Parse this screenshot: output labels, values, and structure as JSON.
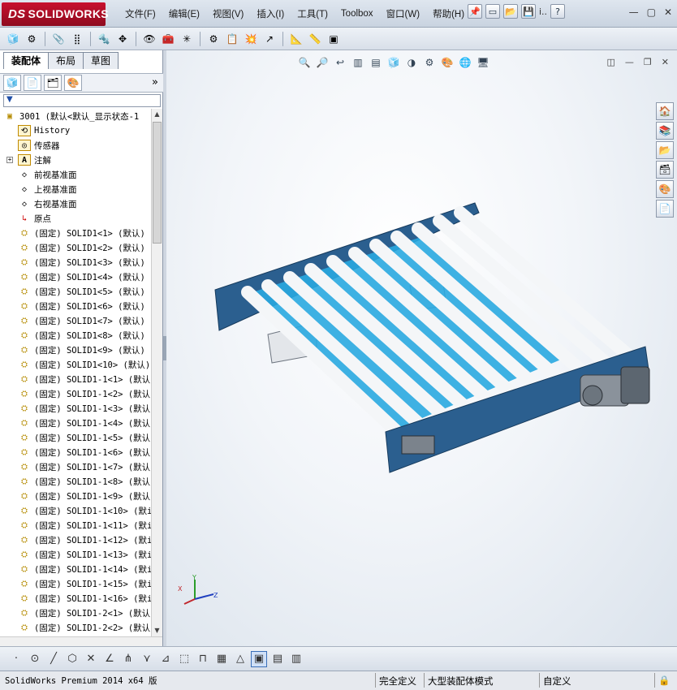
{
  "app": {
    "brand_ds": "DS",
    "brand_name": "SOLIDWORKS"
  },
  "menu": [
    "文件(F)",
    "编辑(E)",
    "视图(V)",
    "插入(I)",
    "工具(T)",
    "Toolbox",
    "窗口(W)",
    "帮助(H)"
  ],
  "title_tools_extra": "i..",
  "tabs": [
    "装配体",
    "布局",
    "草图"
  ],
  "tree": {
    "root": "3001  (默认<默认_显示状态-1",
    "fixed_items": [
      {
        "label": "History",
        "icon": "history-icon"
      },
      {
        "label": "传感器",
        "icon": "sensor-icon"
      },
      {
        "label": "注解",
        "icon": "annotation-icon"
      },
      {
        "label": "前视基准面",
        "icon": "plane-icon"
      },
      {
        "label": "上视基准面",
        "icon": "plane-icon"
      },
      {
        "label": "右视基准面",
        "icon": "plane-icon"
      },
      {
        "label": "原点",
        "icon": "origin-icon"
      }
    ],
    "components": [
      "(固定) SOLID1<1> (默认)",
      "(固定) SOLID1<2> (默认)",
      "(固定) SOLID1<3> (默认)",
      "(固定) SOLID1<4> (默认)",
      "(固定) SOLID1<5> (默认)",
      "(固定) SOLID1<6> (默认)",
      "(固定) SOLID1<7> (默认)",
      "(固定) SOLID1<8> (默认)",
      "(固定) SOLID1<9> (默认)",
      "(固定) SOLID1<10> (默认)",
      "(固定) SOLID1-1<1> (默认",
      "(固定) SOLID1-1<2> (默认",
      "(固定) SOLID1-1<3> (默认",
      "(固定) SOLID1-1<4> (默认",
      "(固定) SOLID1-1<5> (默认",
      "(固定) SOLID1-1<6> (默认",
      "(固定) SOLID1-1<7> (默认",
      "(固定) SOLID1-1<8> (默认",
      "(固定) SOLID1-1<9> (默认",
      "(固定) SOLID1-1<10> (默i",
      "(固定) SOLID1-1<11> (默i",
      "(固定) SOLID1-1<12> (默i",
      "(固定) SOLID1-1<13> (默i",
      "(固定) SOLID1-1<14> (默i",
      "(固定) SOLID1-1<15> (默i",
      "(固定) SOLID1-1<16> (默i",
      "(固定) SOLID1-2<1> (默认",
      "(固定) SOLID1-2<2> (默认"
    ]
  },
  "status": {
    "version": "SolidWorks Premium 2014 x64 版",
    "define": "完全定义",
    "mode": "大型装配体模式",
    "custom": "自定义"
  },
  "colors": {
    "frame_blue": "#2b5f8f",
    "belt_cyan": "#29a9e0",
    "roller_white": "#f4f6f8"
  }
}
